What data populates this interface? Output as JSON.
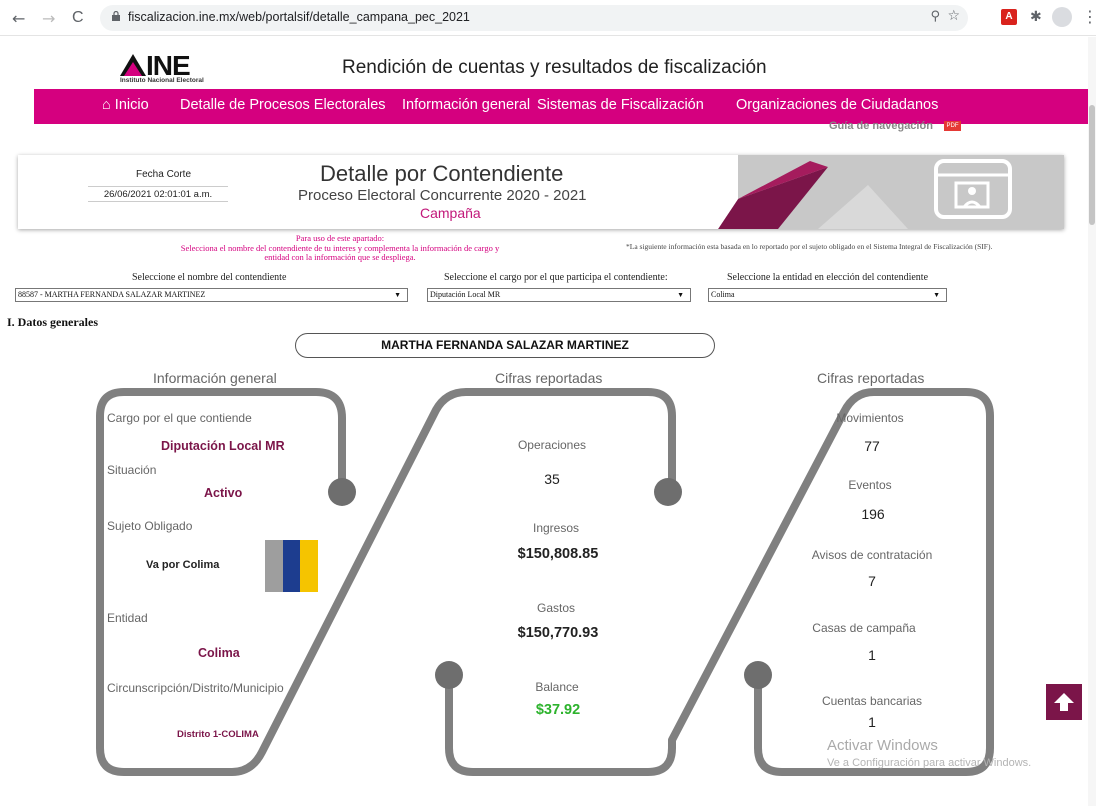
{
  "browser": {
    "url": "fiscalizacion.ine.mx/web/portalsif/detalle_campana_pec_2021",
    "back": "←",
    "forward": "→",
    "reload": "C",
    "zoom_glyph": "⚲",
    "star_glyph": "☆",
    "pdf_ext_glyph": "A",
    "puzzle_glyph": "✱",
    "more_glyph": "⋮"
  },
  "header": {
    "logo_text": "INE",
    "logo_sub": "Instituto Nacional Electoral",
    "title": "Rendición de cuentas y resultados de fiscalización"
  },
  "nav": {
    "items": [
      {
        "label": "Inicio",
        "icon": "home-icon"
      },
      {
        "label": "Detalle de Procesos Electorales"
      },
      {
        "label": "Información general"
      },
      {
        "label": "Sistemas de Fiscalización"
      },
      {
        "label": "Organizaciones de Ciudadanos"
      }
    ],
    "home_glyph": "⌂",
    "guide": "Guía de navegación",
    "guide_badge": "PDF"
  },
  "banner": {
    "fecha_label": "Fecha Corte",
    "fecha_value": "26/06/2021 02:01:01 a.m.",
    "title": "Detalle por Contendiente",
    "subtitle": "Proceso Electoral Concurrente 2020 - 2021",
    "campaign": "Campaña",
    "accent": "#8a1a52"
  },
  "instructions": {
    "line1": "Para uso de este apartado:",
    "line2": "Selecciona el nombre del contendiente de tu interes y complementa la información de cargo y",
    "line3": "entidad con la información que se despliega.",
    "note": "*La siguiente información esta basada en lo reportado por el sujeto obligado en el Sistema Integral de Fiscalización (SIF)."
  },
  "selects": {
    "name_label": "Seleccione el nombre del contendiente",
    "name_value": "88587 - MARTHA FERNANDA SALAZAR MARTINEZ",
    "cargo_label": "Seleccione el cargo por el que participa el contendiente:",
    "cargo_value": "Diputación Local MR",
    "entidad_label": "Seleccione la entidad en elección del contendiente",
    "entidad_value": "Colima",
    "arrow": "▼"
  },
  "section": {
    "title": "I. Datos generales",
    "candidate": "MARTHA FERNANDA SALAZAR MARTINEZ"
  },
  "panel_info": {
    "heading": "Información general",
    "cargo_label": "Cargo por el que contiende",
    "cargo_value": "Diputación Local MR",
    "situacion_label": "Situación",
    "situacion_value": "Activo",
    "sujeto_label": "Sujeto Obligado",
    "sujeto_value": "Va por Colima",
    "entidad_label": "Entidad",
    "entidad_value": "Colima",
    "circ_label": "Circunscripción/Distrito/Municipio",
    "circ_value": "Distrito 1-COLIMA"
  },
  "panel_cifras1": {
    "heading": "Cifras reportadas",
    "operaciones_label": "Operaciones",
    "operaciones_value": "35",
    "ingresos_label": "Ingresos",
    "ingresos_value": "$150,808.85",
    "gastos_label": "Gastos",
    "gastos_value": "$150,770.93",
    "balance_label": "Balance",
    "balance_value": "$37.92",
    "balance_color": "#2db32d"
  },
  "panel_cifras2": {
    "heading": "Cifras reportadas",
    "movimientos_label": "Movimientos",
    "movimientos_value": "77",
    "eventos_label": "Eventos",
    "eventos_value": "196",
    "avisos_label": "Avisos de contratación",
    "avisos_value": "7",
    "casas_label": "Casas de campaña",
    "casas_value": "1",
    "cuentas_label": "Cuentas bancarias",
    "cuentas_value": "1"
  },
  "overlay": {
    "activate_title": "Activar Windows",
    "activate_sub": "Ve a Configuración para activar Windows.",
    "totop_glyph": "🡅"
  },
  "colors": {
    "brand": "#d5007f",
    "maroon": "#7b1549",
    "frame": "#808080"
  }
}
